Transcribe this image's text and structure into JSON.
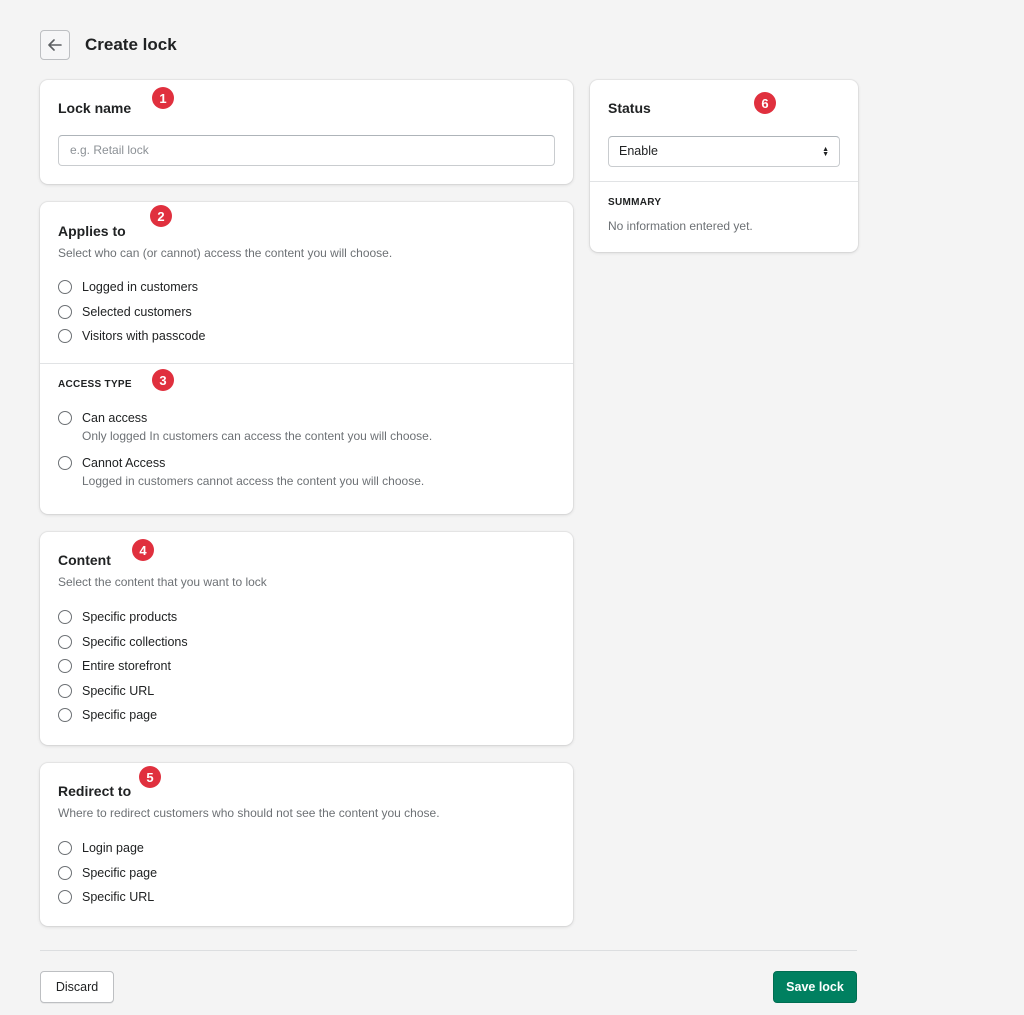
{
  "header": {
    "title": "Create lock",
    "back_icon": "arrow-left-icon"
  },
  "lock_name": {
    "title": "Lock name",
    "placeholder": "e.g. Retail lock",
    "value": "",
    "badge": "1"
  },
  "applies_to": {
    "title": "Applies to",
    "subtitle": "Select who can (or cannot) access the content you will choose.",
    "badge": "2",
    "options": [
      "Logged in customers",
      "Selected customers",
      "Visitors with passcode"
    ]
  },
  "access_type": {
    "label": "ACCESS TYPE",
    "badge": "3",
    "options": [
      {
        "label": "Can access",
        "help": "Only logged In customers can access the content you will choose."
      },
      {
        "label": "Cannot Access",
        "help": "Logged in customers cannot access the content you will choose."
      }
    ]
  },
  "content": {
    "title": "Content",
    "subtitle": "Select the content that you want to lock",
    "badge": "4",
    "options": [
      "Specific products",
      "Specific collections",
      "Entire storefront",
      "Specific URL",
      "Specific page"
    ]
  },
  "redirect": {
    "title": "Redirect to",
    "subtitle": "Where to redirect customers who should not see the content you chose.",
    "badge": "5",
    "options": [
      "Login page",
      "Specific page",
      "Specific URL"
    ]
  },
  "status": {
    "title": "Status",
    "badge": "6",
    "selected": "Enable",
    "summary_label": "SUMMARY",
    "summary_text": "No information entered yet."
  },
  "footer": {
    "discard_label": "Discard",
    "save_label": "Save lock"
  },
  "colors": {
    "primary": "#008060",
    "badge": "#e0303e",
    "background": "#f4f4f4"
  }
}
